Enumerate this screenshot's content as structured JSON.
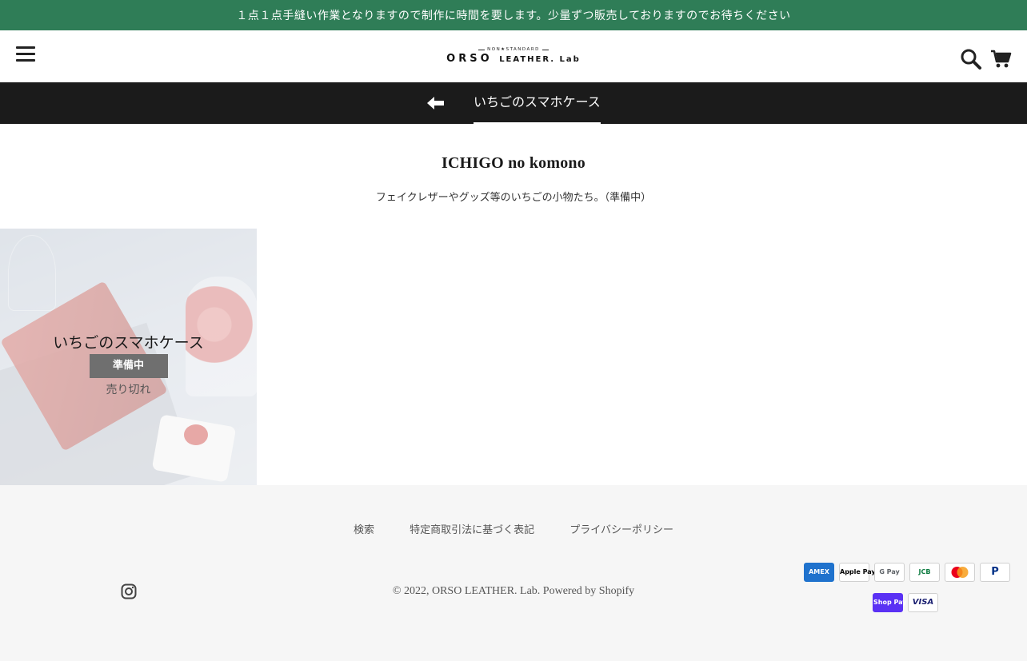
{
  "announcement": "１点１点手縫い作業となりますので制作に時間を要します。少量ずつ販売しておりますのでお待ちください",
  "logo": {
    "tagline": "NON★STANDARD",
    "brand": "ORSO",
    "brand_suffix": "LEATHER. Lab"
  },
  "subnav": {
    "title": "いちごのスマホケース"
  },
  "collection": {
    "title": "ICHIGO no komono",
    "description": "フェイクレザーやグッズ等のいちごの小物たち。（準備中）"
  },
  "product": {
    "name": "いちごのスマホケース",
    "badge": "準備中",
    "status": "売り切れ"
  },
  "footer": {
    "links": [
      "検索",
      "特定商取引法に基づく表記",
      "プライバシーポリシー"
    ],
    "copyright": "© 2022, ORSO LEATHER. Lab. Powered by Shopify",
    "payments": [
      "AMEX",
      "Apple Pay",
      "G Pay",
      "JCB",
      "Mastercard",
      "PayPal",
      "Shop Pay",
      "VISA"
    ]
  },
  "colors": {
    "announcement_bg": "#2f7d57",
    "subnav_bg": "#1b1b1b",
    "footer_bg": "#f6f6f6"
  },
  "icons": [
    "menu-icon",
    "search-icon",
    "cart-icon",
    "back-arrow-icon",
    "instagram-icon"
  ]
}
